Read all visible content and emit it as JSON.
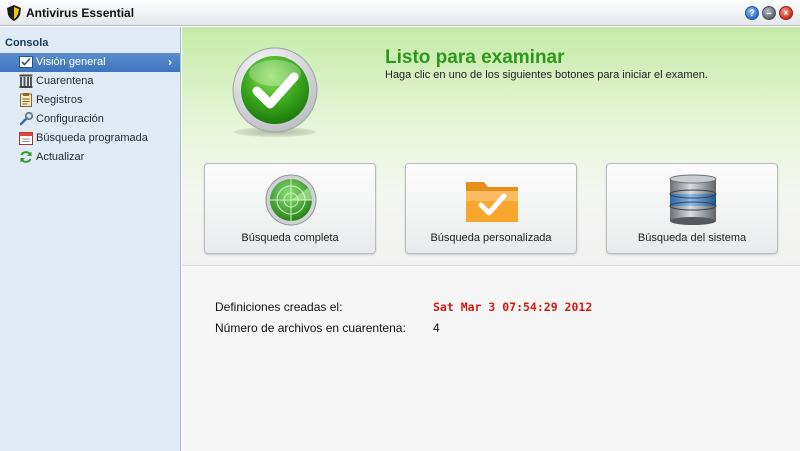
{
  "window": {
    "title": "Antivirus Essential",
    "buttons": [
      "help",
      "minimize",
      "close"
    ]
  },
  "sidebar": {
    "header": "Consola",
    "items": [
      {
        "label": "Visión general",
        "icon": "overview-icon",
        "active": true
      },
      {
        "label": "Cuarentena",
        "icon": "quarantine-icon",
        "active": false
      },
      {
        "label": "Registros",
        "icon": "logs-icon",
        "active": false
      },
      {
        "label": "Configuración",
        "icon": "wrench-icon",
        "active": false
      },
      {
        "label": "Búsqueda programada",
        "icon": "calendar-icon",
        "active": false
      },
      {
        "label": "Actualizar",
        "icon": "refresh-icon",
        "active": false
      }
    ]
  },
  "hero": {
    "title": "Listo para examinar",
    "subtitle": "Haga clic en uno de los siguientes botones para iniciar el examen.",
    "icon": "checkmark-icon"
  },
  "scans": [
    {
      "label": "Búsqueda completa",
      "icon": "radar-icon"
    },
    {
      "label": "Búsqueda personalizada",
      "icon": "folder-check-icon"
    },
    {
      "label": "Búsqueda del sistema",
      "icon": "database-icon"
    }
  ],
  "info": {
    "definitions_label": "Definiciones creadas el:",
    "definitions_value": "Sat Mar 3 07:54:29 2012",
    "quarantine_label": "Número de archivos en cuarentena:",
    "quarantine_value": "4"
  },
  "colors": {
    "accent_green": "#2b9a1c",
    "selection_blue": "#4a80c7",
    "date_red": "#d51a12",
    "sidebar_bg": "#e0ebf6"
  }
}
